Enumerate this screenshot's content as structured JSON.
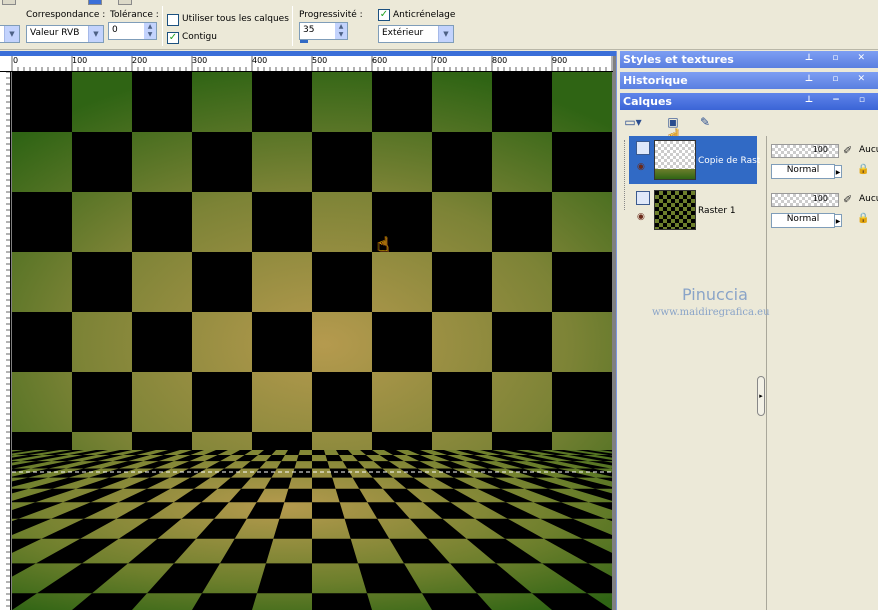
{
  "toolbar": {
    "correspondance_label": "Correspondance :",
    "correspondance_value": "Valeur RVB",
    "tolerance_label": "Tolérance :",
    "tolerance_value": "0",
    "use_all_layers_label": "Utiliser tous les calques",
    "use_all_layers_checked": false,
    "contigu_label": "Contigu",
    "contigu_checked": true,
    "progressivite_label": "Progressivité :",
    "progressivite_value": "35",
    "anticrenelage_label": "Anticrénelage",
    "anticrenelage_checked": true,
    "mode_value": "Extérieur"
  },
  "ruler": {
    "ticks": [
      "0",
      "100",
      "200",
      "300",
      "400",
      "500",
      "600",
      "700",
      "800",
      "900"
    ]
  },
  "panels": {
    "styles_title": "Styles et textures",
    "history_title": "Historique",
    "layers_title": "Calques"
  },
  "layers": [
    {
      "name": "Copie de Rast",
      "opacity": "100",
      "blend": "Normal",
      "mask": "Aucu",
      "selected": true
    },
    {
      "name": "Raster 1",
      "opacity": "100",
      "blend": "Normal",
      "mask": "Aucu",
      "selected": false
    }
  ],
  "watermark": {
    "name": "Pinuccia",
    "url": "www.maidiregrafica.eu"
  },
  "colors": {
    "green": "#3a6a1c",
    "gold": "#b59a4e",
    "black": "#000000",
    "selection": "#316ac5",
    "panel_title": "#5a7fe0"
  },
  "icons": [
    "new-layer-icon",
    "layer-icon",
    "hand-pointer-icon",
    "eye-icon",
    "brush-icon",
    "lock-icon"
  ]
}
